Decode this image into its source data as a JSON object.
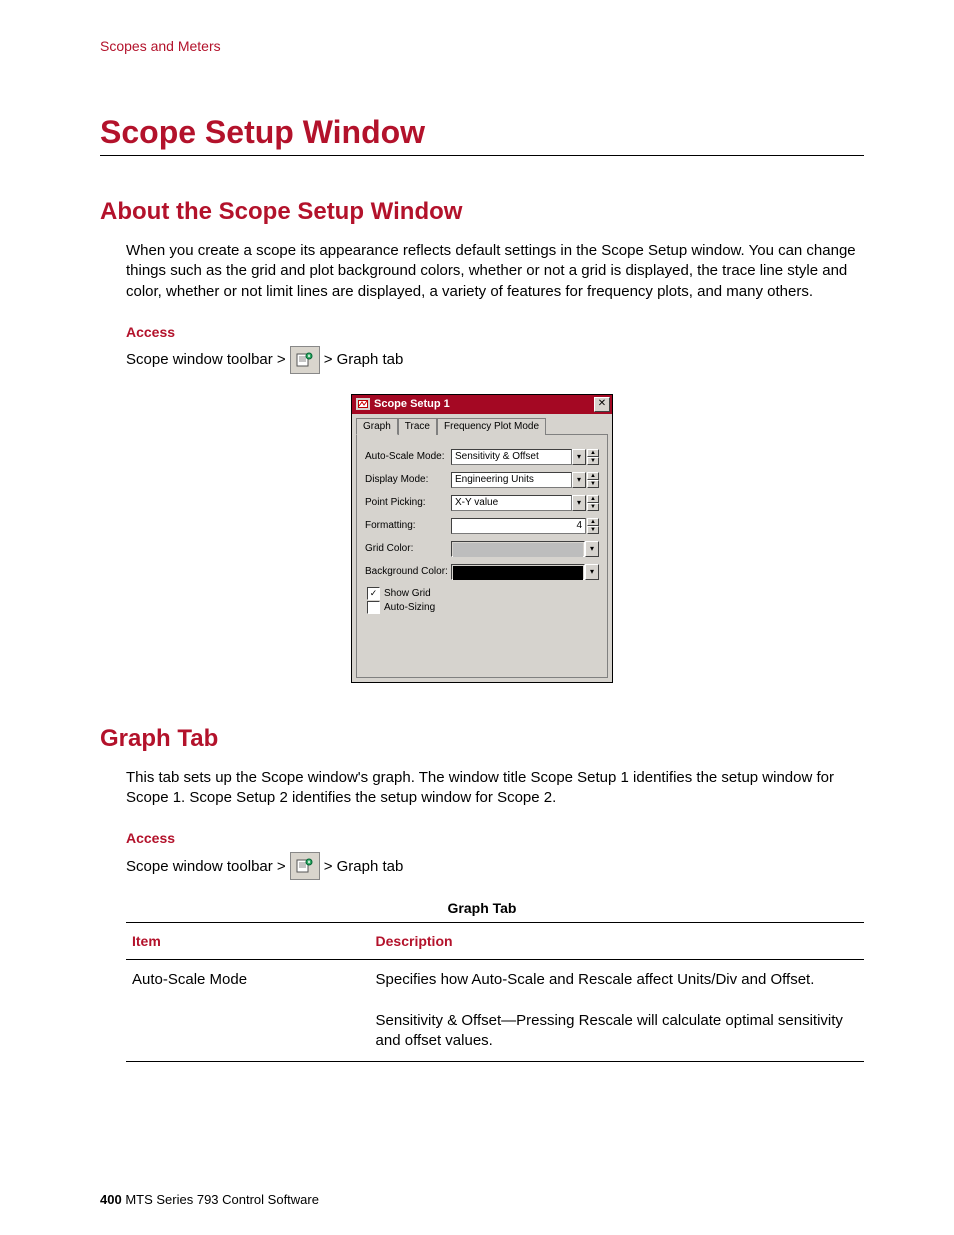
{
  "header": {
    "section": "Scopes and Meters"
  },
  "title": "Scope Setup Window",
  "about": {
    "heading": "About the Scope Setup Window",
    "body": "When you create a scope its appearance reflects default settings in the Scope Setup window. You can change things such as the grid and plot background colors, whether or not a grid is displayed, the trace line style and color, whether or not limit lines are displayed, a variety of features for frequency plots, and many others.",
    "access_label": "Access",
    "access_prefix": "Scope window toolbar >",
    "access_suffix": "> Graph tab"
  },
  "dialog": {
    "title": "Scope Setup 1",
    "tabs": [
      "Graph",
      "Trace",
      "Frequency Plot Mode"
    ],
    "active_tab": 0,
    "fields": {
      "auto_scale": {
        "label": "Auto-Scale Mode:",
        "value": "Sensitivity & Offset"
      },
      "display_mode": {
        "label": "Display Mode:",
        "value": "Engineering Units"
      },
      "point_picking": {
        "label": "Point Picking:",
        "value": "X-Y value"
      },
      "formatting": {
        "label": "Formatting:",
        "value": "4"
      },
      "grid_color": {
        "label": "Grid Color:",
        "value": "#bdbdbd"
      },
      "background_color": {
        "label": "Background Color:",
        "value": "#000000"
      }
    },
    "checks": {
      "show_grid": {
        "label": "Show Grid",
        "checked": true
      },
      "auto_sizing": {
        "label": "Auto-Sizing",
        "checked": false
      }
    }
  },
  "graph_tab": {
    "heading": "Graph Tab",
    "body": "This tab sets up the Scope window's graph. The window title Scope Setup 1 identifies the setup window for Scope 1. Scope Setup 2 identifies the setup window for Scope 2.",
    "access_label": "Access",
    "access_prefix": "Scope window toolbar >",
    "access_suffix": "> Graph tab",
    "table_caption": "Graph Tab",
    "table": {
      "col_item": "Item",
      "col_desc": "Description",
      "rows": [
        {
          "item": "Auto-Scale Mode",
          "desc": "Specifies how Auto-Scale and Rescale affect Units/Div and Offset."
        },
        {
          "item": "",
          "desc": "Sensitivity & Offset—Pressing Rescale will calculate optimal sensitivity and offset values."
        }
      ]
    }
  },
  "footer": {
    "page": "400",
    "product": "MTS Series 793 Control Software"
  }
}
